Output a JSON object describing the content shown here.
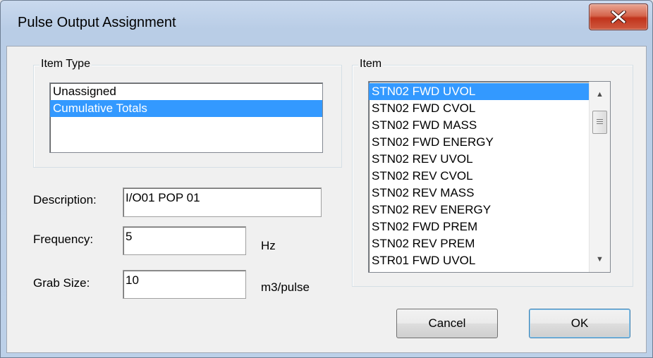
{
  "window": {
    "title": "Pulse Output Assignment",
    "close_glyph": "X"
  },
  "item_type": {
    "label": "Item Type",
    "options": [
      "Unassigned",
      "Cumulative Totals"
    ],
    "selected": "Cumulative Totals"
  },
  "item": {
    "label": "Item",
    "options": [
      "STN02 FWD UVOL",
      "STN02 FWD CVOL",
      "STN02 FWD MASS",
      "STN02 FWD ENERGY",
      "STN02 REV UVOL",
      "STN02 REV CVOL",
      "STN02 REV MASS",
      "STN02 REV ENERGY",
      "STN02 FWD PREM",
      "STN02 REV PREM",
      "STR01 FWD UVOL"
    ],
    "selected": "STN02 FWD UVOL"
  },
  "fields": {
    "description": {
      "label": "Description:",
      "value": "I/O01 POP 01"
    },
    "frequency": {
      "label": "Frequency:",
      "value": "5",
      "unit": "Hz"
    },
    "grab_size": {
      "label": "Grab Size:",
      "value": "10",
      "unit": "m3/pulse"
    }
  },
  "buttons": {
    "cancel": "Cancel",
    "ok": "OK"
  },
  "icons": {
    "close": "close-icon",
    "scroll_up": "scroll-up-arrow-icon",
    "scroll_down": "scroll-down-arrow-icon",
    "scroll_thumb": "scrollbar-thumb-grip-icon"
  },
  "colors": {
    "selection": "#3399ff",
    "close_button": "#c1341c",
    "title_bar": "#b9cde6"
  }
}
